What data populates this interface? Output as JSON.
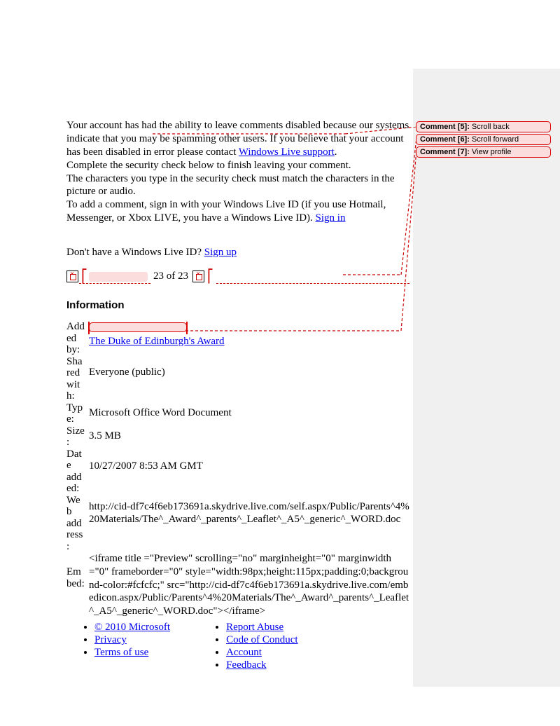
{
  "body": {
    "para1_a": "Your account has had the ability to leave comments disabled because our systems indicate that you may be spamming other users. If you believe that your account has been disabled in error please contact ",
    "para1_link": "Windows Live support",
    "para1_b": ".",
    "para2": "Complete the security check below to finish leaving your comment.",
    "para3": "The characters you type in the security check must match the characters in the picture or audio.",
    "para4_a": "To add a comment, sign in with your Windows Live ID (if you use Hotmail, Messenger, or Xbox LIVE, you have a Windows Live ID). ",
    "para4_link": "Sign in",
    "para5_a": "Don't have a Windows Live ID? ",
    "para5_link": "Sign up",
    "pager_text": "23 of 23"
  },
  "section_title": "Information",
  "info": {
    "added_by_label": "Added by:",
    "added_by_link": "The Duke of Edinburgh's Award",
    "shared_label": "Shared with:",
    "shared_val": "Everyone (public)",
    "type_label": "Type:",
    "type_val": "Microsoft Office Word Document",
    "size_label": "Size:",
    "size_val": "3.5 MB",
    "date_label": "Date added:",
    "date_val": "10/27/2007 8:53 AM GMT",
    "web_label": "Web address:",
    "web_val": "http://cid-df7c4f6eb173691a.skydrive.live.com/self.aspx/Public/Parents^4%20Materials/The^_Award^_parents^_Leaflet^_A5^_generic^_WORD.doc",
    "embed_label": "Embed:",
    "embed_val": "<iframe title =\"Preview\" scrolling=\"no\" marginheight=\"0\" marginwidth=\"0\" frameborder=\"0\" style=\"width:98px;height:115px;padding:0;background-color:#fcfcfc;\" src=\"http://cid-df7c4f6eb173691a.skydrive.live.com/embedicon.aspx/Public/Parents^4%20Materials/The^_Award^_parents^_Leaflet^_A5^_generic^_WORD.doc\"></iframe>"
  },
  "footer_left": [
    "© 2010 Microsoft",
    "Privacy",
    "Terms of use"
  ],
  "footer_right": [
    "Report Abuse",
    "Code of Conduct",
    "Account",
    "Feedback"
  ],
  "comments": [
    {
      "label": "Comment [5]:",
      "text": "Scroll back"
    },
    {
      "label": "Comment [6]:",
      "text": "Scroll forward"
    },
    {
      "label": "Comment [7]:",
      "text": "View profile"
    }
  ]
}
